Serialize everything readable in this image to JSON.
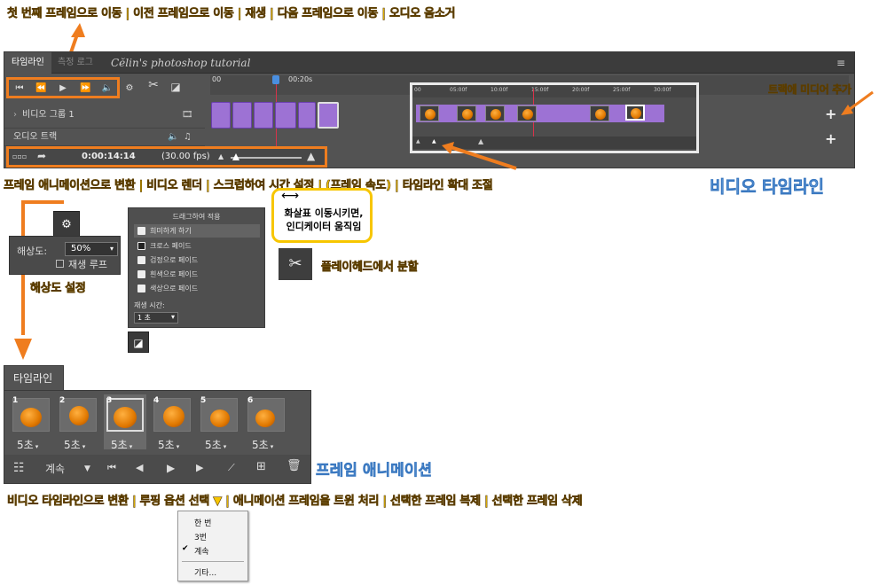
{
  "annotations": {
    "top": "첫 번째 프레임으로 이동 | 이전 프레임으로 이동 | 재생 | 다음 프레임으로 이동 | 오디오 음소거",
    "add_media": "트랙에 미디어 추가",
    "bottom_bar": "프레임 애니메이션으로 변환 | 비디오 렌더 | 스크럽하여 시간 설정 | (프레임 속도) | 타임라인 확대 조절",
    "video_timeline": "비디오 타임라인",
    "resolution_setting": "해상도 설정",
    "move_indicator": "화살표 이동시키면,\n인디케이터 움직임",
    "split_playhead": "플레이헤드에서 분할",
    "frame_animation": "프레임 애니메이션",
    "frame_bottom": "비디오 타임라인으로 변환 | 루핑 옵션 선택 ▼ | 애니메이션 프레임을 트윈 처리 | 선택한 프레임 복제 | 선택한 프레임 삭제"
  },
  "timeline": {
    "tab_active": "타임라인",
    "tab_inactive": "측정 로그",
    "watermark": "Cĕlin's photoshop tutorial",
    "ruler_labels": [
      "00",
      "00:20s"
    ],
    "video_group": "비디오 그룹 1",
    "audio_track": "오디오 트랙",
    "timecode": "0:00:14:14",
    "fps": "(30.00 fps)",
    "menu_icon": "menu-icon"
  },
  "mini_timeline": {
    "ruler": [
      "00",
      "05:00f",
      "10:00f",
      "15:00f",
      "20:00f",
      "25:00f",
      "30:00f"
    ]
  },
  "resolution": {
    "label": "해상도:",
    "value": "50%",
    "loop_label": "재생 루프"
  },
  "transitions": {
    "title": "드래그하여 적용",
    "items": [
      "희미하게 하기",
      "크로스 페이드",
      "검정으로 페이드",
      "흰색으로 페이드",
      "색상으로 페이드"
    ],
    "duration_label": "재생 시간:",
    "duration_value": "1 초"
  },
  "frame_panel": {
    "tab": "타임라인",
    "frames": [
      {
        "num": "1",
        "dur": "5초"
      },
      {
        "num": "2",
        "dur": "5초"
      },
      {
        "num": "3",
        "dur": "5초"
      },
      {
        "num": "4",
        "dur": "5초"
      },
      {
        "num": "5",
        "dur": "5초"
      },
      {
        "num": "6",
        "dur": "5초"
      }
    ],
    "loop_value": "계속"
  },
  "loop_menu": {
    "items": [
      "한 번",
      "3번",
      "계속",
      "기타..."
    ]
  }
}
